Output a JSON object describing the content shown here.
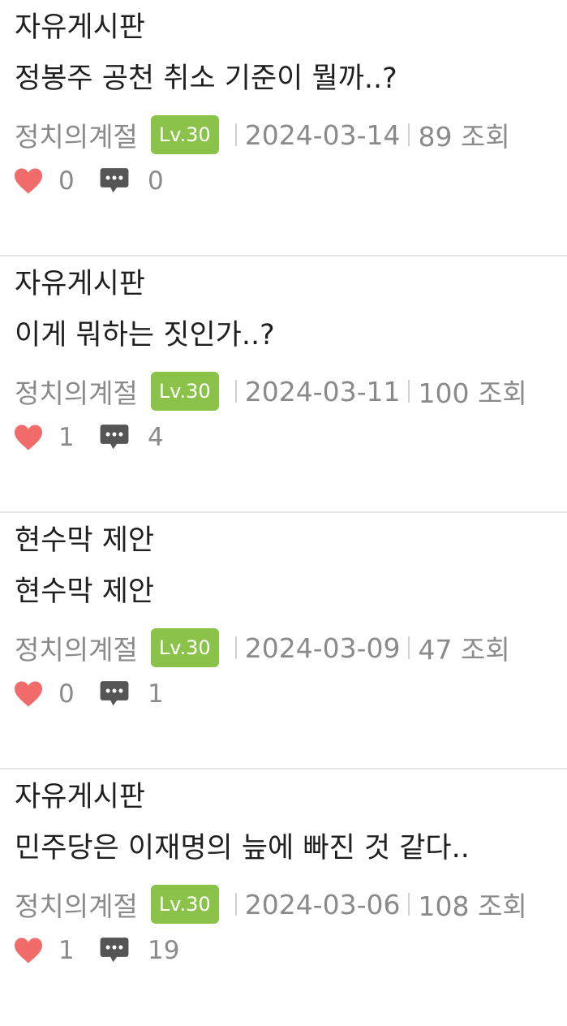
{
  "colors": {
    "heart": "#f26b6b",
    "level_badge": "#8bc34a",
    "comment_icon": "#555555"
  },
  "posts": [
    {
      "category": "자유게시판",
      "title": "정봉주 공천 취소 기준이 뭘까..?",
      "author": "정치의계절",
      "level": "Lv.30",
      "date": "2024-03-14",
      "views": "89 조회",
      "likes": "0",
      "comments": "0"
    },
    {
      "category": "자유게시판",
      "title": "이게 뭐하는 짓인가..?",
      "author": "정치의계절",
      "level": "Lv.30",
      "date": "2024-03-11",
      "views": "100 조회",
      "likes": "1",
      "comments": "4"
    },
    {
      "category": "현수막 제안",
      "title": "현수막 제안",
      "author": "정치의계절",
      "level": "Lv.30",
      "date": "2024-03-09",
      "views": "47 조회",
      "likes": "0",
      "comments": "1"
    },
    {
      "category": "자유게시판",
      "title": "민주당은 이재명의 늪에 빠진 것 같다..",
      "author": "정치의계절",
      "level": "Lv.30",
      "date": "2024-03-06",
      "views": "108 조회",
      "likes": "1",
      "comments": "19"
    }
  ]
}
